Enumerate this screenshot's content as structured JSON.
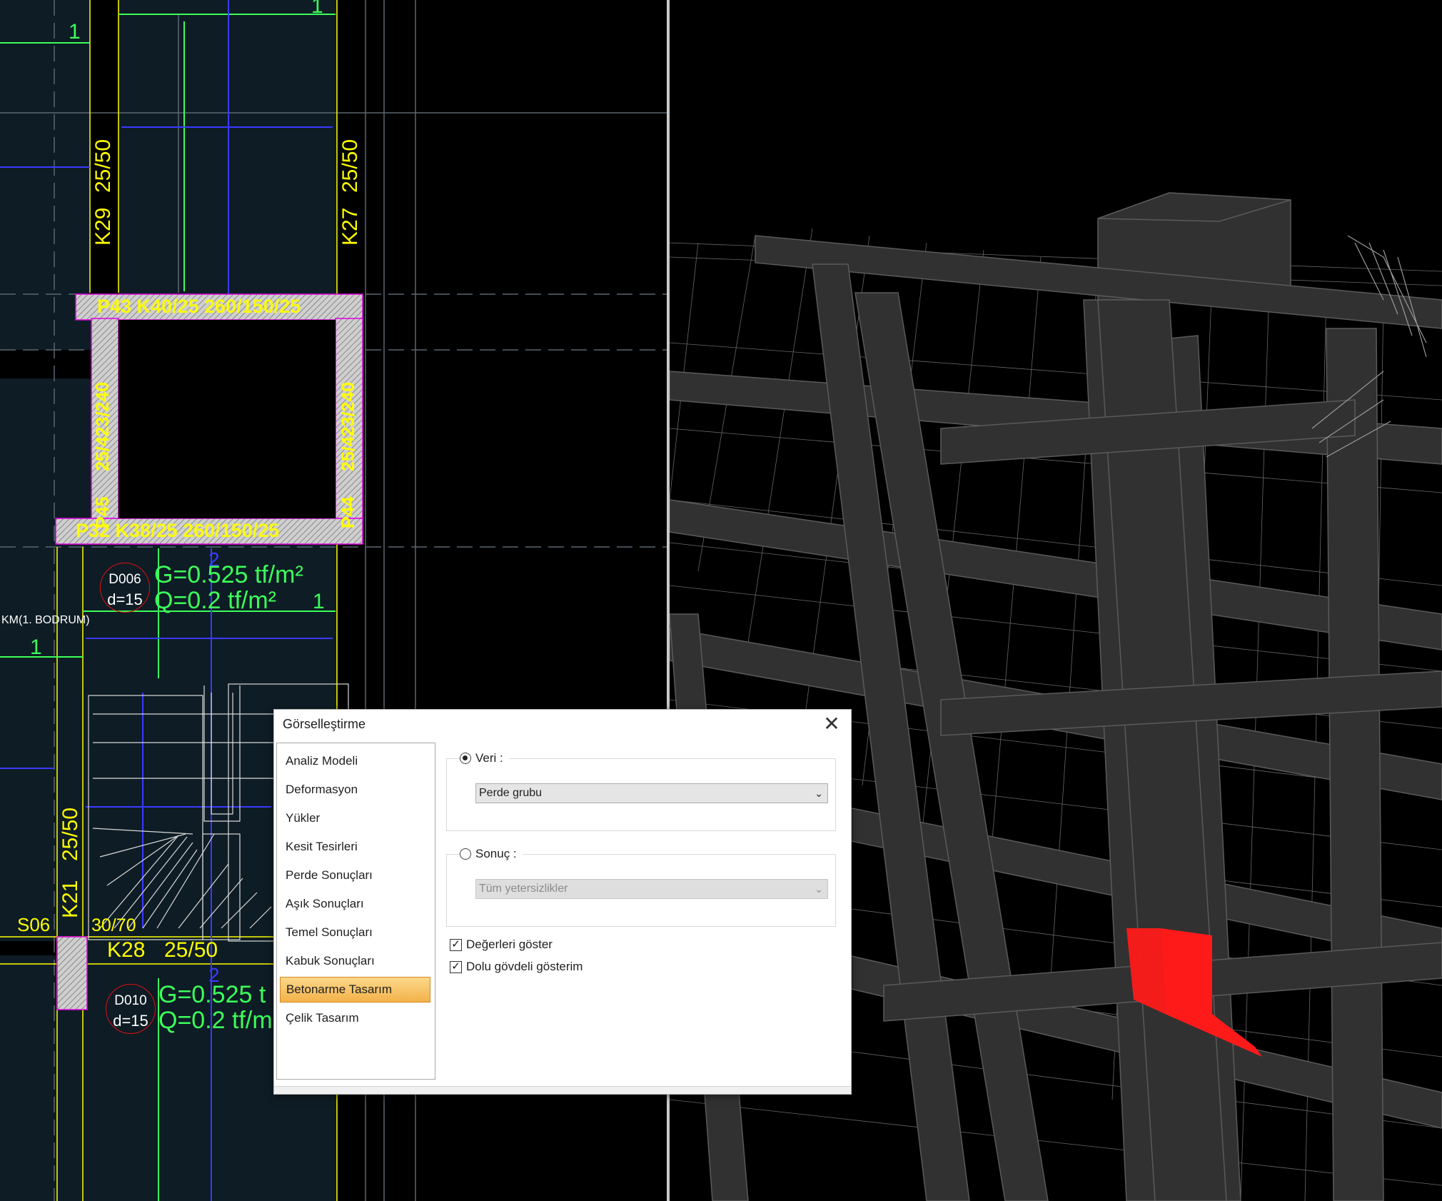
{
  "plan": {
    "column_labels": [
      "K29",
      "K27",
      "K21",
      "K28",
      "S06"
    ],
    "beam_sizes": [
      "25/50",
      "25/50",
      "25/50",
      "25/50",
      "30/70"
    ],
    "axis_marks": [
      "1",
      "1",
      "1",
      "1",
      "2",
      "2"
    ],
    "wall_labels": [
      "P43 K40/25 260/150/25",
      "P32 K38/25 260/150/25",
      "25/423/240",
      "25/423/240",
      "P45",
      "P44"
    ],
    "story_label": "KM(1. BODRUM)",
    "slabs": [
      {
        "id": "D006",
        "thickness": "d=15",
        "G": "G=0.525 tf/m²",
        "Q": "Q=0.2 tf/m²"
      },
      {
        "id": "D010",
        "thickness": "d=15",
        "G": "G=0.525 t",
        "Q": "Q=0.2 tf/m"
      }
    ]
  },
  "colors": {
    "cad_background": "#0e1c25",
    "cad_yellow": "#ffff00",
    "cad_green": "#3cff5a",
    "cad_blue": "#3a3aff",
    "highlight_red": "#ff1a1a",
    "selected_gradient": "#f3b24a"
  },
  "dialog": {
    "title": "Görselleştirme",
    "close_icon": "close-icon",
    "nav_items": [
      "Analiz Modeli",
      "Deformasyon",
      "Yükler",
      "Kesit Tesirleri",
      "Perde Sonuçları",
      "Aşık Sonuçları",
      "Temel Sonuçları",
      "Kabuk Sonuçları",
      "Betonarme Tasarım",
      "Çelik Tasarım"
    ],
    "selected_nav": "Betonarme Tasarım",
    "veri": {
      "label": "Veri :",
      "selected": true,
      "value": "Perde grubu"
    },
    "sonuc": {
      "label": "Sonuç :",
      "selected": false,
      "value": "Tüm yetersizlikler",
      "disabled": true
    },
    "checkboxes": [
      {
        "label": "Değerleri göster",
        "checked": true
      },
      {
        "label": "Dolu gövdeli gösterim",
        "checked": true
      }
    ]
  }
}
